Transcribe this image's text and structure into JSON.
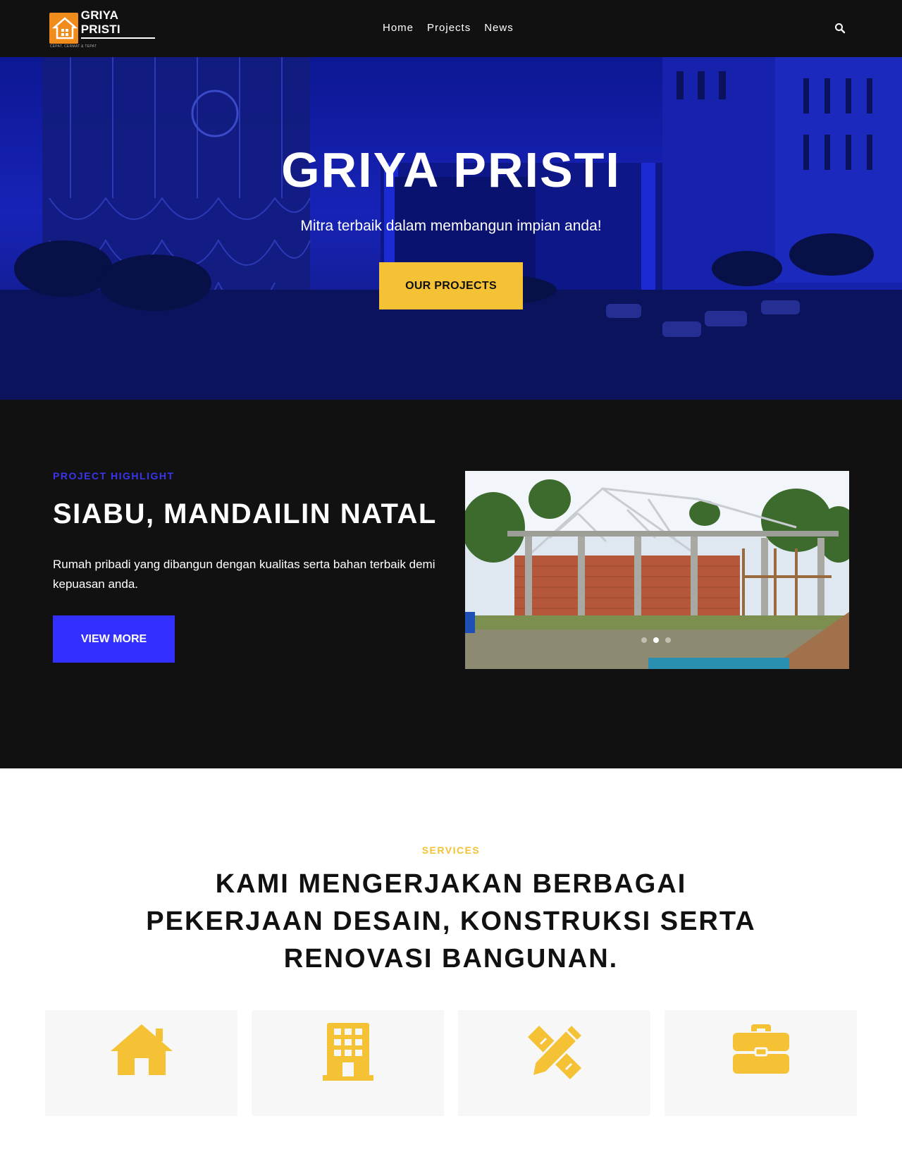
{
  "header": {
    "brand": "GRIYA PRISTI",
    "brand_tagline": "CEPAT, CERMAT & TEPAT",
    "nav": [
      {
        "label": "Home"
      },
      {
        "label": "Projects"
      },
      {
        "label": "News"
      }
    ],
    "search_icon": "search-icon"
  },
  "hero": {
    "title": "GRIYA PRISTI",
    "subtitle": "Mitra terbaik dalam membangun impian anda!",
    "button_label": "OUR PROJECTS"
  },
  "highlight": {
    "eyebrow": "PROJECT HIGHLIGHT",
    "title": "SIABU, MANDAILIN NATAL",
    "description": "Rumah pribadi yang dibangun dengan kualitas serta bahan terbaik demi kepuasan anda.",
    "button_label": "VIEW MORE",
    "slides_count": 3,
    "active_slide": 2
  },
  "services": {
    "eyebrow": "SERVICES",
    "title": "KAMI MENGERJAKAN BERBAGAI PEKERJAAN DESAIN, KONSTRUKSI SERTA RENOVASI BANGUNAN.",
    "cards": [
      {
        "icon": "home-icon"
      },
      {
        "icon": "building-icon"
      },
      {
        "icon": "pencil-ruler-icon"
      },
      {
        "icon": "briefcase-icon"
      }
    ]
  },
  "colors": {
    "header_bg": "#111111",
    "accent_yellow": "#f4c234",
    "accent_blue": "#3330ff",
    "eyebrow_blue": "#3a34f0",
    "logo_orange": "#f08c1c"
  }
}
